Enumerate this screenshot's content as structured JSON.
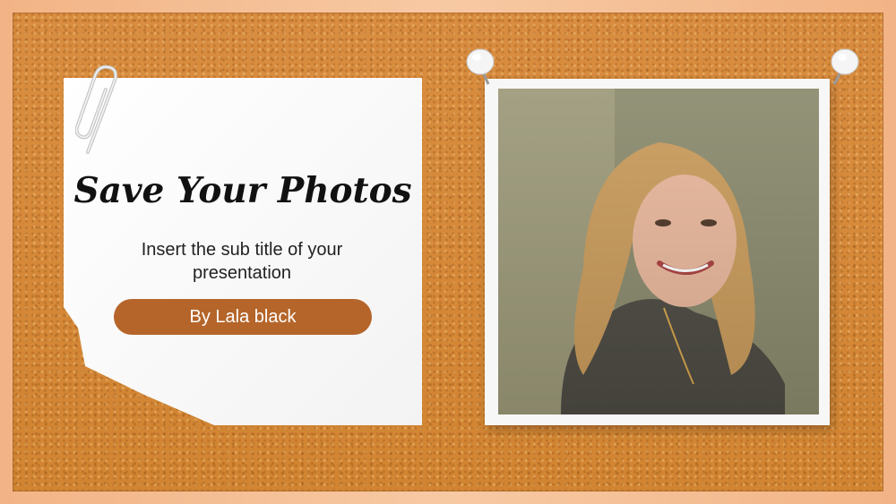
{
  "slide": {
    "title": "Save Your Photos",
    "subtitle": "Insert the sub title of your presentation",
    "byline": "By Lala black",
    "accent_color": "#b5652a"
  },
  "decor": {
    "paperclip_icon": "paperclip-icon",
    "pushpin_icon": "pushpin-icon"
  }
}
